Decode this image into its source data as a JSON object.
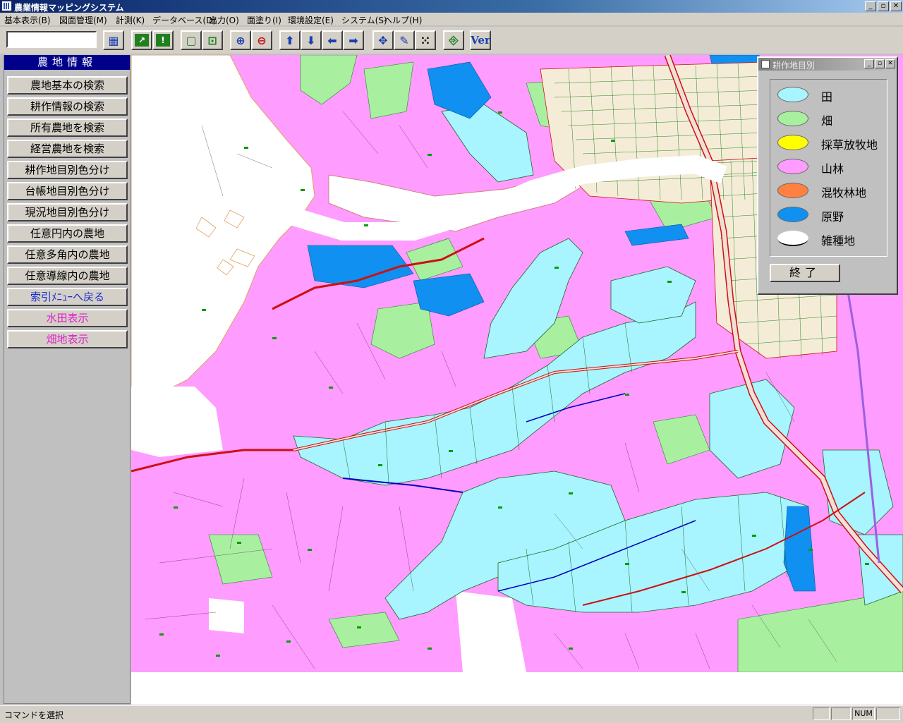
{
  "window": {
    "title": "農業情報マッピングシステム",
    "minimize": "_",
    "maximize": "▫",
    "close": "✕"
  },
  "menu": [
    "基本表示(B)",
    "図面管理(M)",
    "計測(K)",
    "データベース(D)",
    "出力(O)",
    "面塗り(I)",
    "環境設定(E)",
    "システム(S)",
    "ヘルプ(H)"
  ],
  "toolbar": {
    "icons": [
      "grid-icon",
      "select-area-icon",
      "monitor-alert-icon",
      "frame-icon",
      "frame-fit-icon",
      "zoom-in-icon",
      "zoom-out-icon",
      "arrow-up-icon",
      "arrow-down-icon",
      "arrow-left-icon",
      "arrow-right-icon",
      "pan-icon",
      "pen-icon",
      "dots-icon",
      "door-exit-icon"
    ],
    "version_label": "Ver"
  },
  "panel": {
    "header": "農地情報",
    "buttons": [
      "農地基本の検索",
      "耕作情報の検索",
      "所有農地を検索",
      "経営農地を検索",
      "耕作地目別色分け",
      "台帳地目別色分け",
      "現況地目別色分け",
      "任意円内の農地",
      "任意多角内の農地",
      "任意導線内の農地"
    ],
    "index_button": "索引ﾒﾆｭｰへ戻る",
    "rice_button": "水田表示",
    "field_button": "畑地表示"
  },
  "legend": {
    "title": "耕作地目別",
    "items": [
      {
        "label": "田",
        "color": "#a8f4ff"
      },
      {
        "label": "畑",
        "color": "#a8f0a0"
      },
      {
        "label": "採草放牧地",
        "color": "#ffff00"
      },
      {
        "label": "山林",
        "color": "#ff9cff"
      },
      {
        "label": "混牧林地",
        "color": "#ff8040"
      },
      {
        "label": "原野",
        "color": "#1090f0"
      },
      {
        "label": "雑種地",
        "color": "#ffffff"
      }
    ],
    "close_button": "終了"
  },
  "status": {
    "text": "コマンドを選択",
    "num": "NUM"
  },
  "colors": {
    "paddy": "#a8f4ff",
    "field": "#a8f0a0",
    "forest": "#ff9cff",
    "wild": "#1090f0",
    "road": "#f0e0d8",
    "boundary": "#cc1010"
  }
}
